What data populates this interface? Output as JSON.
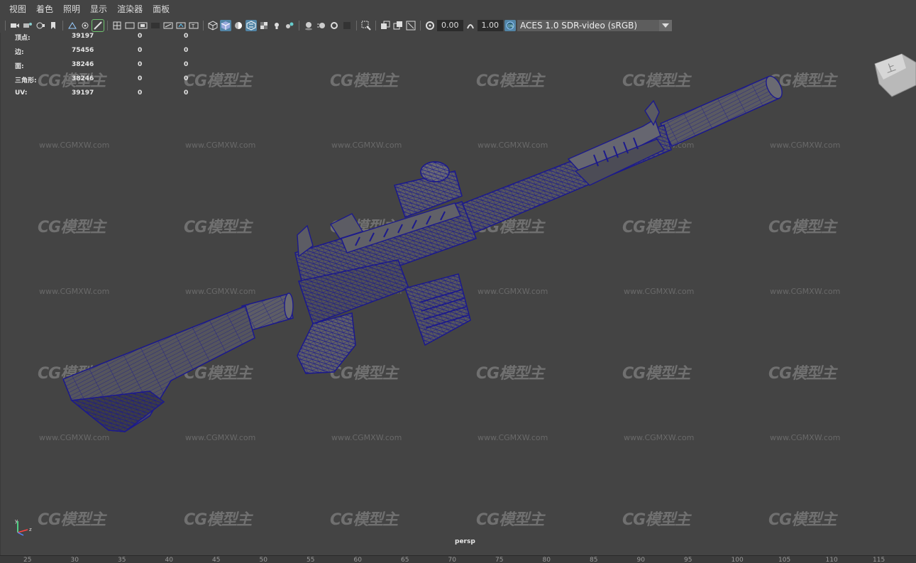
{
  "menu": [
    "视图",
    "着色",
    "照明",
    "显示",
    "渲染器",
    "面板"
  ],
  "toolbar": {
    "exposure_value": "0.00",
    "gamma_value": "1.00",
    "color_space": "ACES 1.0 SDR-video (sRGB)",
    "icons": [
      "camera-icon",
      "camera-attributes-icon",
      "bookmark-icon",
      "image-plane-icon",
      "grid-icon",
      "film-gate-icon",
      "resolution-gate-icon",
      "gate-mask-icon",
      "field-chart-icon",
      "safe-action-icon",
      "safe-title-icon",
      "wireframe-icon",
      "smooth-shade-icon",
      "default-material-icon",
      "wireframe-on-shaded-icon",
      "xray-icon",
      "use-lights-icon",
      "shadows-icon",
      "screen-space-ao-icon",
      "motion-blur-icon",
      "multisample-aa-icon",
      "depth-of-field-icon",
      "isolate-select-icon",
      "exposure-icon",
      "gamma-icon",
      "color-management-icon"
    ]
  },
  "hud": {
    "rows": [
      {
        "label": "顶点:",
        "v1": "39197",
        "v2": "0",
        "v3": "0"
      },
      {
        "label": "边:",
        "v1": "75456",
        "v2": "0",
        "v3": "0"
      },
      {
        "label": "面:",
        "v1": "38246",
        "v2": "0",
        "v3": "0"
      },
      {
        "label": "三角形:",
        "v1": "38246",
        "v2": "0",
        "v3": "0"
      },
      {
        "label": "UV:",
        "v1": "39197",
        "v2": "0",
        "v3": "0"
      }
    ]
  },
  "viewport": {
    "camera_label": "persp",
    "viewcube_face": "上",
    "wireframe_color": "#1c1a8c",
    "watermark_logo": "CG模型主",
    "watermark_url": "www.CGMXW.com"
  },
  "timeline": {
    "ticks": [
      "25",
      "30",
      "35",
      "40",
      "45",
      "50",
      "55",
      "60",
      "65",
      "70",
      "75",
      "80",
      "85",
      "90",
      "95",
      "100",
      "105",
      "110",
      "115"
    ]
  }
}
